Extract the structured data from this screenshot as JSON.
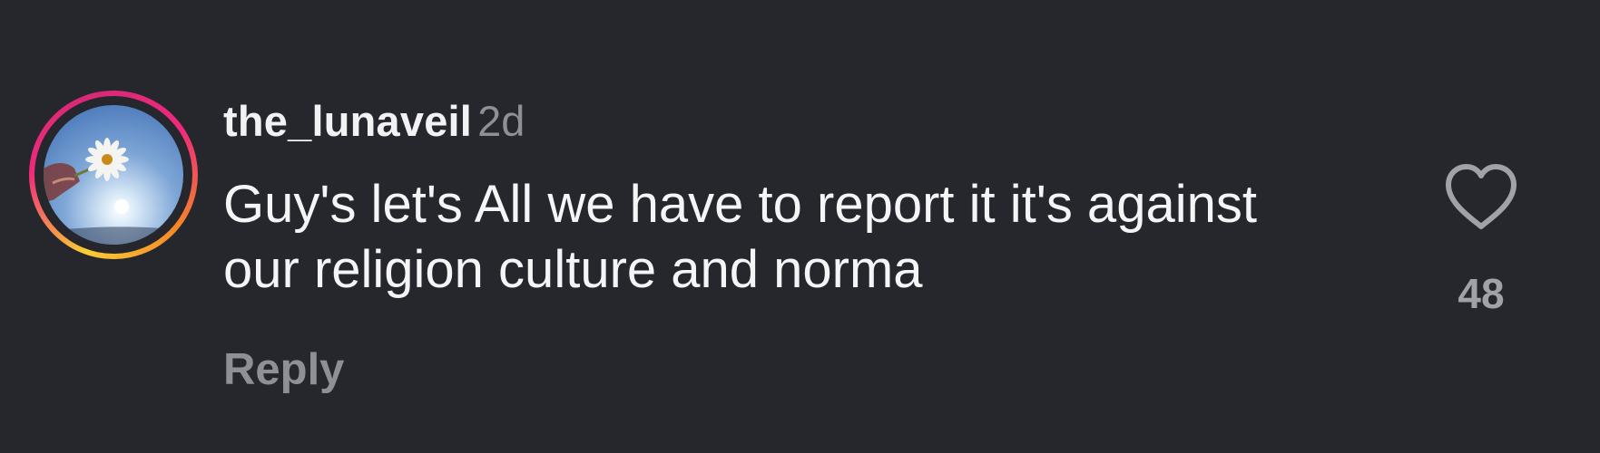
{
  "comment": {
    "username": "the_lunaveil",
    "timestamp": "2d",
    "text": "Guy's let's All we have to report it it's against our religion culture and norma",
    "reply_label": "Reply",
    "like_count": "48",
    "avatar_icon": "profile-photo-daisy",
    "like_icon": "heart-outline-icon"
  },
  "colors": {
    "background": "#25272c",
    "primary_text": "#f5f5f7",
    "secondary_text": "#8e9096",
    "ring_gradient": [
      "#f9ce34",
      "#ee2a7b",
      "#d62976",
      "#f58529"
    ]
  }
}
